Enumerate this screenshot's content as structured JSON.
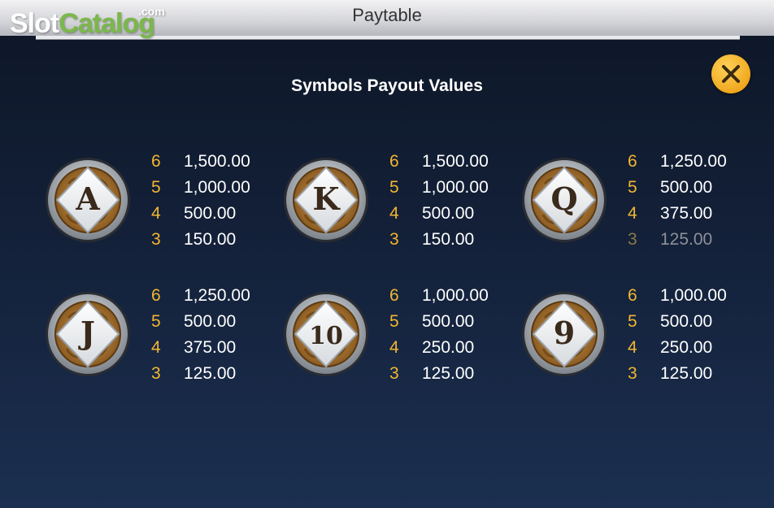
{
  "header": {
    "title": "Paytable",
    "logo": {
      "part1": "Slot",
      "part2": "Catalog",
      "suffix": ".com"
    }
  },
  "subtitle": "Symbols Payout Values",
  "colors": {
    "accent": "#f2b632",
    "close_button": "#f0a81e",
    "background": "#132038"
  },
  "symbols": [
    {
      "glyph": "A",
      "icon": "letter-a-icon",
      "payouts": [
        {
          "count": "6",
          "value": "1,500.00"
        },
        {
          "count": "5",
          "value": "1,000.00"
        },
        {
          "count": "4",
          "value": "500.00"
        },
        {
          "count": "3",
          "value": "150.00"
        }
      ]
    },
    {
      "glyph": "K",
      "icon": "letter-k-icon",
      "payouts": [
        {
          "count": "6",
          "value": "1,500.00"
        },
        {
          "count": "5",
          "value": "1,000.00"
        },
        {
          "count": "4",
          "value": "500.00"
        },
        {
          "count": "3",
          "value": "150.00"
        }
      ]
    },
    {
      "glyph": "Q",
      "icon": "letter-q-icon",
      "payouts": [
        {
          "count": "6",
          "value": "1,250.00"
        },
        {
          "count": "5",
          "value": "500.00"
        },
        {
          "count": "4",
          "value": "375.00"
        },
        {
          "count": "3",
          "value": "125.00"
        }
      ]
    },
    {
      "glyph": "J",
      "icon": "letter-j-icon",
      "payouts": [
        {
          "count": "6",
          "value": "1,250.00"
        },
        {
          "count": "5",
          "value": "500.00"
        },
        {
          "count": "4",
          "value": "375.00"
        },
        {
          "count": "3",
          "value": "125.00"
        }
      ]
    },
    {
      "glyph": "10",
      "icon": "number-10-icon",
      "payouts": [
        {
          "count": "6",
          "value": "1,000.00"
        },
        {
          "count": "5",
          "value": "500.00"
        },
        {
          "count": "4",
          "value": "250.00"
        },
        {
          "count": "3",
          "value": "125.00"
        }
      ]
    },
    {
      "glyph": "9",
      "icon": "number-9-icon",
      "payouts": [
        {
          "count": "6",
          "value": "1,000.00"
        },
        {
          "count": "5",
          "value": "500.00"
        },
        {
          "count": "4",
          "value": "250.00"
        },
        {
          "count": "3",
          "value": "125.00"
        }
      ]
    }
  ]
}
